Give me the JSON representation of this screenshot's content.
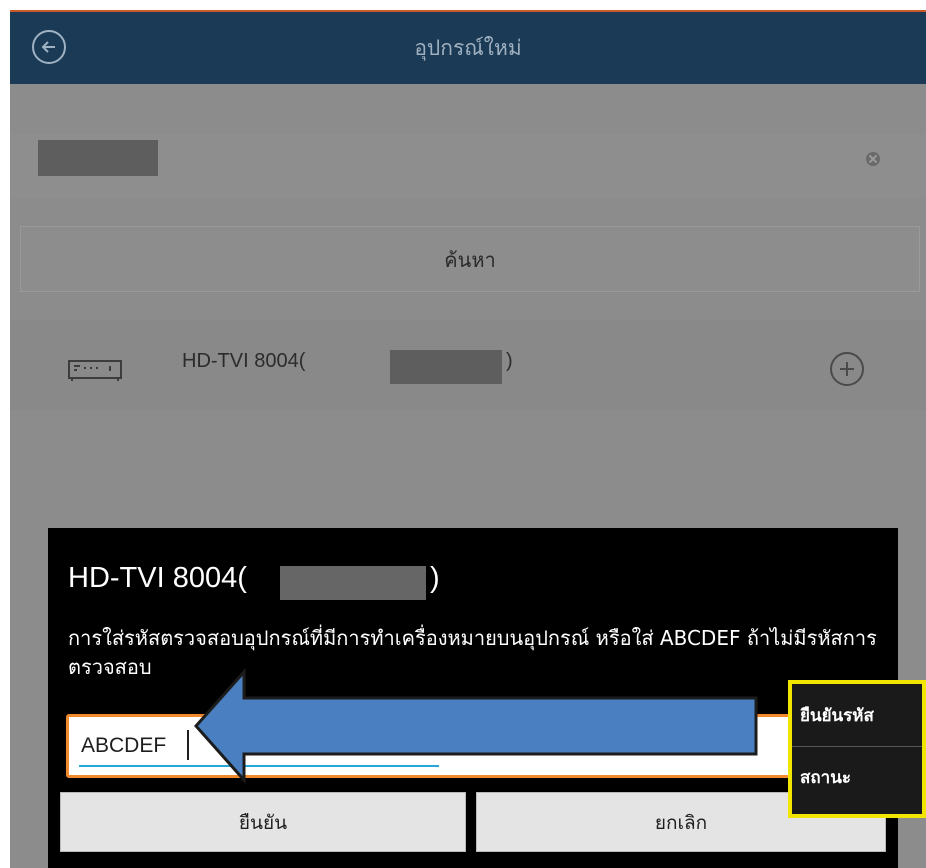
{
  "header": {
    "title": "อุปกรณ์ใหม่"
  },
  "search": {
    "button_label": "ค้นหา"
  },
  "device": {
    "name": "HD-TVI 8004(",
    "close_paren": ")"
  },
  "dialog": {
    "title": "HD-TVI 8004(",
    "title_close": ")",
    "message": "การใส่รหัสตรวจสอบอุปกรณ์ที่มีการทำเครื่องหมายบนอุปกรณ์ หรือใส่ ABCDEF ถ้าไม่มีรหัสการตรวจสอบ",
    "input_value": "ABCDEF",
    "confirm_label": "ยืนยัน",
    "cancel_label": "ยกเลิก"
  },
  "popup": {
    "items": [
      "ยืนยันรหัส",
      "สถานะ"
    ]
  },
  "colors": {
    "header_bg": "#1b3a55",
    "input_border": "#f08a2c",
    "highlight_box": "#f2e600",
    "arrow_fill": "#4a7fc1"
  },
  "icons": [
    "back-arrow-icon",
    "clear-icon",
    "dvr-device-icon",
    "add-icon"
  ]
}
